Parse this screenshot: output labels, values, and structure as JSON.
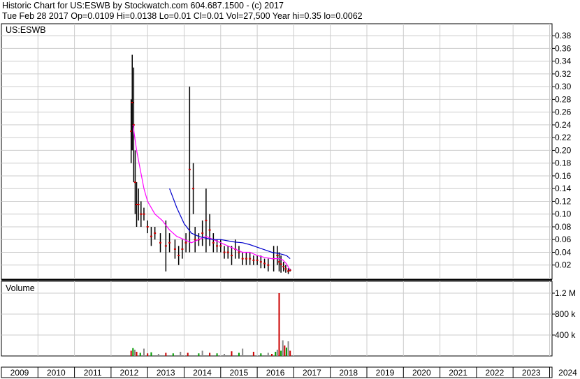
{
  "header": {
    "line1": "Historic Chart for US:ESWB by Stockwatch.com 604.687.1500 - (c) 2017",
    "line2": "Tue Feb 28 2017   Op=0.0109   Hi=0.0138   Lo=0.01   Cl=0.01   Vol=27,500   Year hi=0.35   lo=0.0062"
  },
  "chart_data": [
    {
      "type": "line",
      "title": "US:ESWB",
      "xlabel": "",
      "ylabel": "",
      "ylim": [
        0,
        0.39
      ],
      "y_ticks": [
        "0.02",
        "0.04",
        "0.06",
        "0.08",
        "0.10",
        "0.12",
        "0.14",
        "0.16",
        "0.18",
        "0.20",
        "0.22",
        "0.24",
        "0.26",
        "0.28",
        "0.30",
        "0.32",
        "0.34",
        "0.36",
        "0.38"
      ],
      "x_ticks": [
        "2009",
        "2010",
        "2011",
        "2012",
        "2013",
        "2014",
        "2015",
        "2016",
        "2017",
        "2018",
        "2019",
        "2020",
        "2021",
        "2022",
        "2023",
        "2024"
      ],
      "grid": true,
      "colors": {
        "price": "#000000",
        "close_dots": "#cc0000",
        "ma_fast": "#ff00ff",
        "ma_slow": "#0000cc"
      },
      "series": [
        {
          "kind": "price_bars",
          "x": [
            2012.55,
            2012.58,
            2012.62,
            2012.66,
            2012.7,
            2012.75,
            2012.82,
            2012.9,
            2013.0,
            2013.1,
            2013.2,
            2013.35,
            2013.5,
            2013.6,
            2013.75,
            2013.85,
            2013.95,
            2014.05,
            2014.15,
            2014.25,
            2014.3,
            2014.4,
            2014.5,
            2014.6,
            2014.7,
            2014.8,
            2014.9,
            2015.0,
            2015.1,
            2015.2,
            2015.3,
            2015.4,
            2015.5,
            2015.6,
            2015.7,
            2015.8,
            2015.9,
            2016.0,
            2016.1,
            2016.2,
            2016.3,
            2016.45,
            2016.55,
            2016.6,
            2016.65,
            2016.72,
            2016.78,
            2016.85,
            2016.9
          ],
          "high": [
            0.28,
            0.35,
            0.33,
            0.2,
            0.15,
            0.14,
            0.12,
            0.11,
            0.09,
            0.08,
            0.08,
            0.07,
            0.09,
            0.07,
            0.06,
            0.05,
            0.06,
            0.07,
            0.3,
            0.18,
            0.08,
            0.07,
            0.09,
            0.14,
            0.1,
            0.07,
            0.06,
            0.06,
            0.05,
            0.05,
            0.05,
            0.06,
            0.05,
            0.04,
            0.04,
            0.04,
            0.035,
            0.035,
            0.035,
            0.03,
            0.03,
            0.05,
            0.05,
            0.04,
            0.035,
            0.025,
            0.02,
            0.015,
            0.014
          ],
          "low": [
            0.18,
            0.2,
            0.15,
            0.1,
            0.08,
            0.09,
            0.08,
            0.09,
            0.07,
            0.05,
            0.06,
            0.04,
            0.01,
            0.04,
            0.03,
            0.02,
            0.03,
            0.04,
            0.04,
            0.1,
            0.04,
            0.05,
            0.05,
            0.04,
            0.05,
            0.04,
            0.04,
            0.04,
            0.03,
            0.03,
            0.02,
            0.03,
            0.03,
            0.02,
            0.02,
            0.02,
            0.02,
            0.02,
            0.015,
            0.015,
            0.01,
            0.01,
            0.02,
            0.01,
            0.008,
            0.01,
            0.008,
            0.006,
            0.01
          ]
        },
        {
          "name": "",
          "kind": "ma_fast",
          "x": [
            2012.6,
            2012.7,
            2012.8,
            2012.9,
            2013.0,
            2013.2,
            2013.4,
            2013.6,
            2013.8,
            2014.0,
            2014.2,
            2014.4,
            2014.6,
            2014.8,
            2015.0,
            2015.2,
            2015.4,
            2015.6,
            2015.8,
            2016.0,
            2016.2,
            2016.4,
            2016.6,
            2016.7,
            2016.8,
            2016.9
          ],
          "values": [
            0.24,
            0.2,
            0.17,
            0.14,
            0.12,
            0.1,
            0.09,
            0.075,
            0.065,
            0.06,
            0.055,
            0.06,
            0.065,
            0.06,
            0.055,
            0.05,
            0.045,
            0.04,
            0.04,
            0.035,
            0.032,
            0.03,
            0.03,
            0.028,
            0.022,
            0.012
          ]
        },
        {
          "name": "",
          "kind": "ma_slow",
          "x": [
            2013.6,
            2013.8,
            2014.0,
            2014.2,
            2014.4,
            2014.6,
            2014.8,
            2015.0,
            2015.2,
            2015.4,
            2015.6,
            2015.8,
            2016.0,
            2016.2,
            2016.4,
            2016.6,
            2016.8,
            2016.9
          ],
          "values": [
            0.14,
            0.11,
            0.085,
            0.07,
            0.065,
            0.062,
            0.06,
            0.06,
            0.058,
            0.056,
            0.055,
            0.052,
            0.048,
            0.044,
            0.04,
            0.038,
            0.035,
            0.03
          ]
        }
      ]
    },
    {
      "type": "bar",
      "title": "Volume",
      "xlabel": "",
      "ylabel": "",
      "ylim": [
        0,
        1400000
      ],
      "y_ticks": [
        "400 k",
        "800 k",
        "1.2 M"
      ],
      "x": [
        2012.55,
        2012.6,
        2012.65,
        2012.7,
        2012.8,
        2012.9,
        2013.0,
        2013.1,
        2013.3,
        2013.5,
        2013.7,
        2013.9,
        2014.1,
        2014.4,
        2014.5,
        2014.7,
        2014.9,
        2015.1,
        2015.3,
        2015.5,
        2015.6,
        2015.9,
        2016.1,
        2016.3,
        2016.4,
        2016.5,
        2016.55,
        2016.6,
        2016.65,
        2016.7,
        2016.75,
        2016.8,
        2016.85,
        2016.9
      ],
      "values": [
        100000,
        150000,
        120000,
        80000,
        60000,
        140000,
        50000,
        70000,
        40000,
        60000,
        50000,
        80000,
        60000,
        50000,
        100000,
        60000,
        50000,
        40000,
        90000,
        60000,
        140000,
        80000,
        50000,
        60000,
        40000,
        80000,
        120000,
        1200000,
        100000,
        300000,
        200000,
        160000,
        280000,
        100000
      ],
      "colors": {
        "up": "#009900",
        "down": "#cc0000",
        "neutral": "#888888"
      }
    }
  ]
}
